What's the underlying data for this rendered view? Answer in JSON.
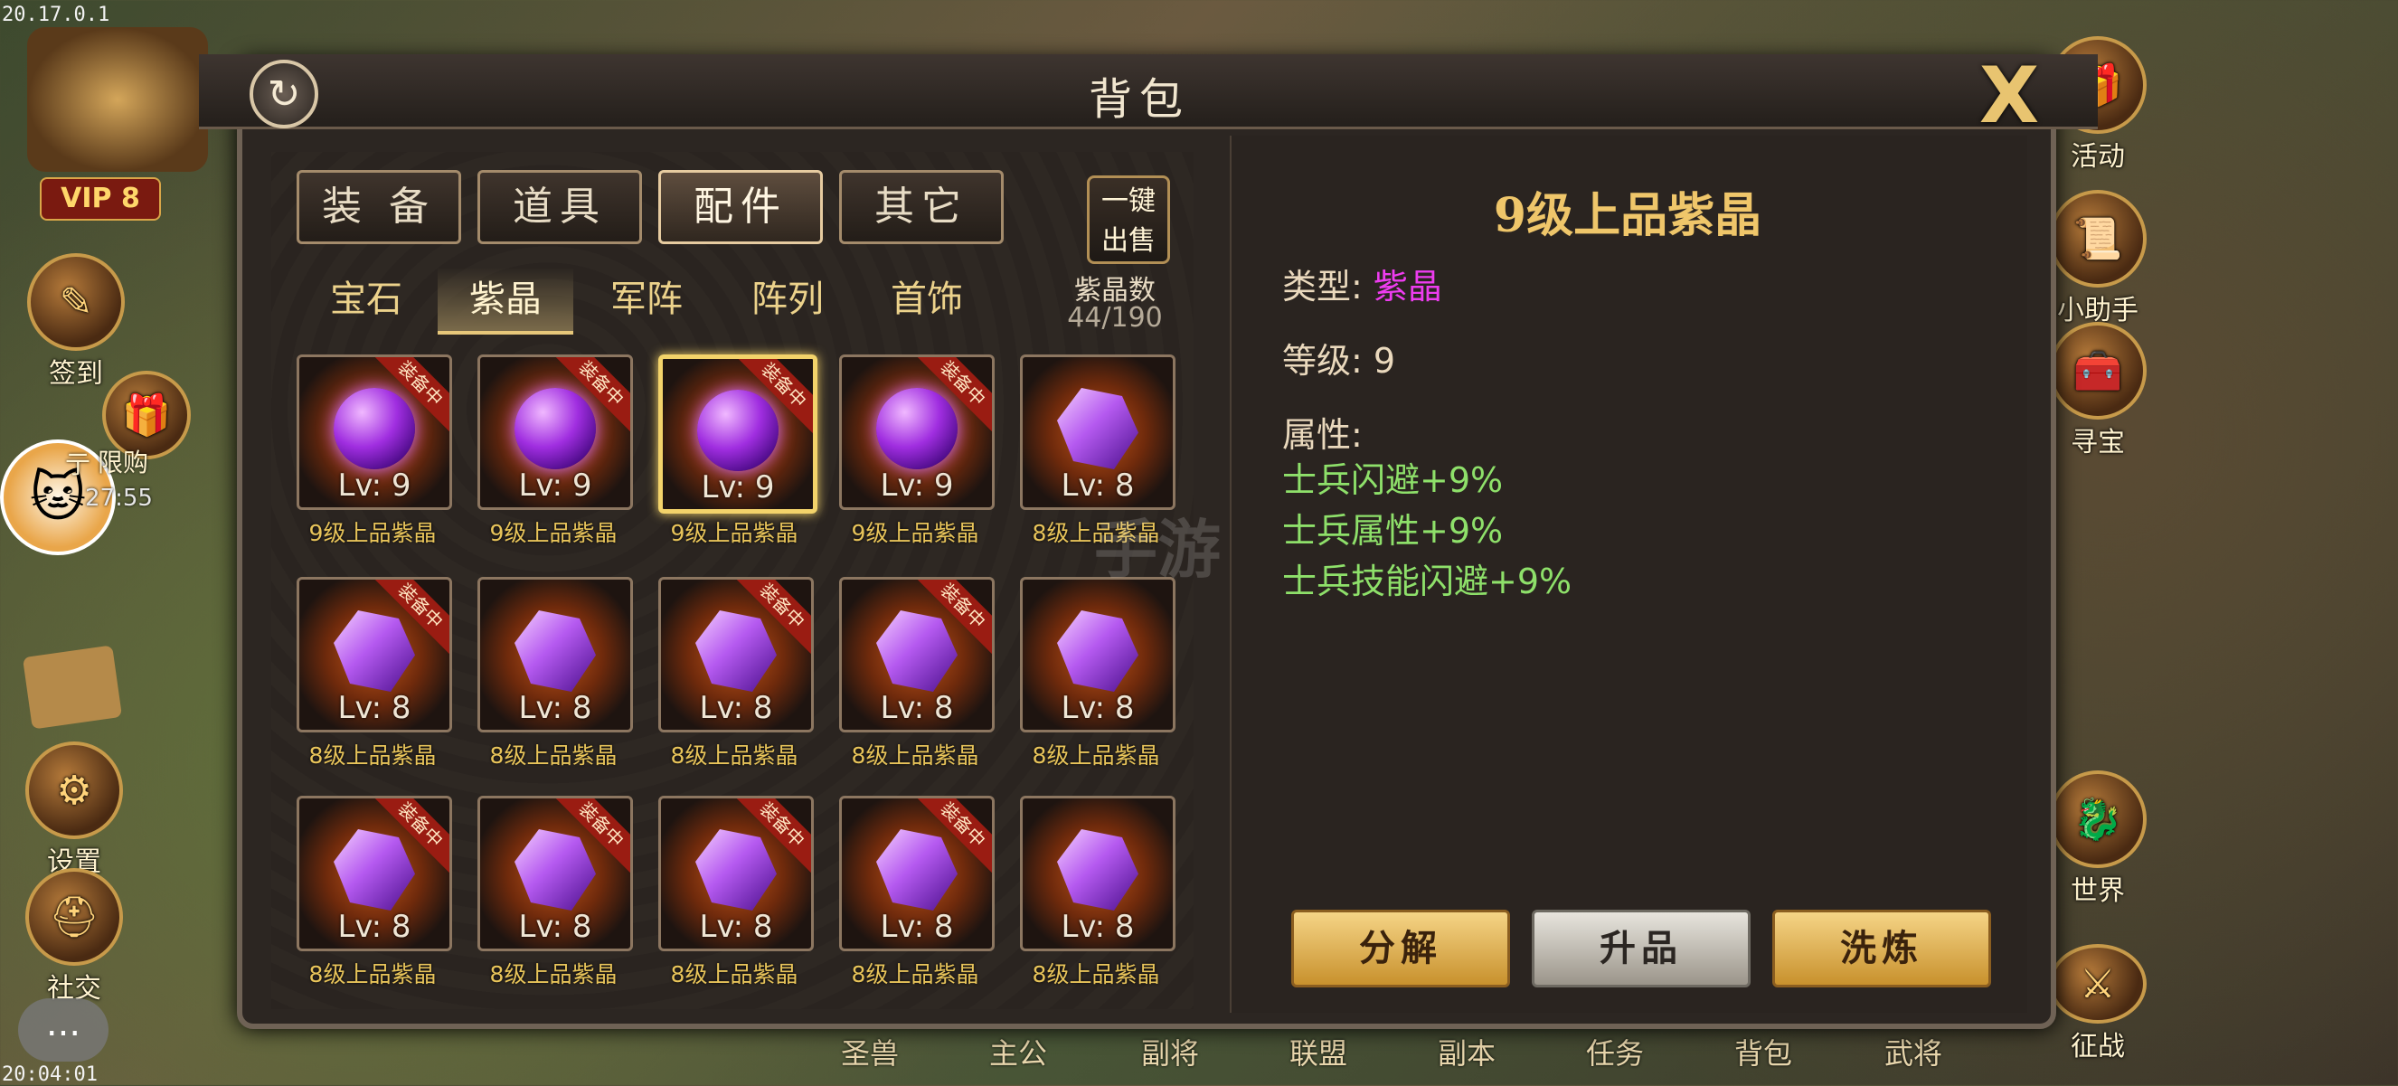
{
  "status_bar": {
    "top_left": "20.17.0.1",
    "bottom_left": "20:04:01"
  },
  "left_menu": {
    "vip": "VIP 8",
    "sign_in": "签到",
    "limited_label": "限购",
    "limited_timer": "27:55",
    "settings": "设置",
    "social": "社交",
    "partial_letter": "亍",
    "more_icon": "..."
  },
  "right_menu": {
    "activity": "活动",
    "helper": "小助手",
    "treasure": "寻宝",
    "world": "世界",
    "campaign": "征战"
  },
  "bottom_nav": [
    "圣兽",
    "主公",
    "副将",
    "联盟",
    "副本",
    "任务",
    "背包",
    "武将"
  ],
  "window": {
    "title": "背包",
    "close_label": "X"
  },
  "tabs": [
    {
      "label": "装 备",
      "active": false
    },
    {
      "label": "道具",
      "active": false
    },
    {
      "label": "配件",
      "active": true
    },
    {
      "label": "其它",
      "active": false
    }
  ],
  "subtabs": [
    {
      "label": "宝石",
      "active": false
    },
    {
      "label": "紫晶",
      "active": true
    },
    {
      "label": "军阵",
      "active": false
    },
    {
      "label": "阵列",
      "active": false
    },
    {
      "label": "首饰",
      "active": false
    }
  ],
  "sell_button": {
    "line1": "一键",
    "line2": "出售"
  },
  "inventory_count": {
    "label": "紫晶数",
    "value": "44/190"
  },
  "items": [
    {
      "name": "9级上品紫晶",
      "level": "Lv: 9",
      "shape": "orb",
      "equipped": true,
      "selected": false
    },
    {
      "name": "9级上品紫晶",
      "level": "Lv: 9",
      "shape": "orb",
      "equipped": true,
      "selected": false
    },
    {
      "name": "9级上品紫晶",
      "level": "Lv: 9",
      "shape": "orb",
      "equipped": true,
      "selected": true
    },
    {
      "name": "9级上品紫晶",
      "level": "Lv: 9",
      "shape": "orb",
      "equipped": true,
      "selected": false
    },
    {
      "name": "8级上品紫晶",
      "level": "Lv: 8",
      "shape": "crystal",
      "equipped": false,
      "selected": false
    },
    {
      "name": "8级上品紫晶",
      "level": "Lv: 8",
      "shape": "crystal",
      "equipped": true,
      "selected": false
    },
    {
      "name": "8级上品紫晶",
      "level": "Lv: 8",
      "shape": "crystal",
      "equipped": false,
      "selected": false
    },
    {
      "name": "8级上品紫晶",
      "level": "Lv: 8",
      "shape": "crystal",
      "equipped": true,
      "selected": false
    },
    {
      "name": "8级上品紫晶",
      "level": "Lv: 8",
      "shape": "crystal",
      "equipped": true,
      "selected": false
    },
    {
      "name": "8级上品紫晶",
      "level": "Lv: 8",
      "shape": "crystal",
      "equipped": false,
      "selected": false
    },
    {
      "name": "8级上品紫晶",
      "level": "Lv: 8",
      "shape": "crystal",
      "equipped": true,
      "selected": false
    },
    {
      "name": "8级上品紫晶",
      "level": "Lv: 8",
      "shape": "crystal",
      "equipped": true,
      "selected": false
    },
    {
      "name": "8级上品紫晶",
      "level": "Lv: 8",
      "shape": "crystal",
      "equipped": true,
      "selected": false
    },
    {
      "name": "8级上品紫晶",
      "level": "Lv: 8",
      "shape": "crystal",
      "equipped": true,
      "selected": false
    },
    {
      "name": "8级上品紫晶",
      "level": "Lv: 8",
      "shape": "crystal",
      "equipped": false,
      "selected": false
    }
  ],
  "equipped_badge": "装备中",
  "detail": {
    "title": "9级上品紫晶",
    "type_label": "类型:",
    "type_value": "紫晶",
    "level_label": "等级:",
    "level_value": "9",
    "attr_label": "属性:",
    "attributes": [
      "士兵闪避+9%",
      "士兵属性+9%",
      "士兵技能闪避+9%"
    ]
  },
  "actions": {
    "decompose": "分解",
    "upgrade": "升品",
    "refine": "洗炼"
  },
  "watermark": "手游",
  "colors": {
    "gold_text": "#e8c45a",
    "purple": "#ee3cf0",
    "green": "#8ee06a",
    "ribbon": "#9a1c12"
  }
}
